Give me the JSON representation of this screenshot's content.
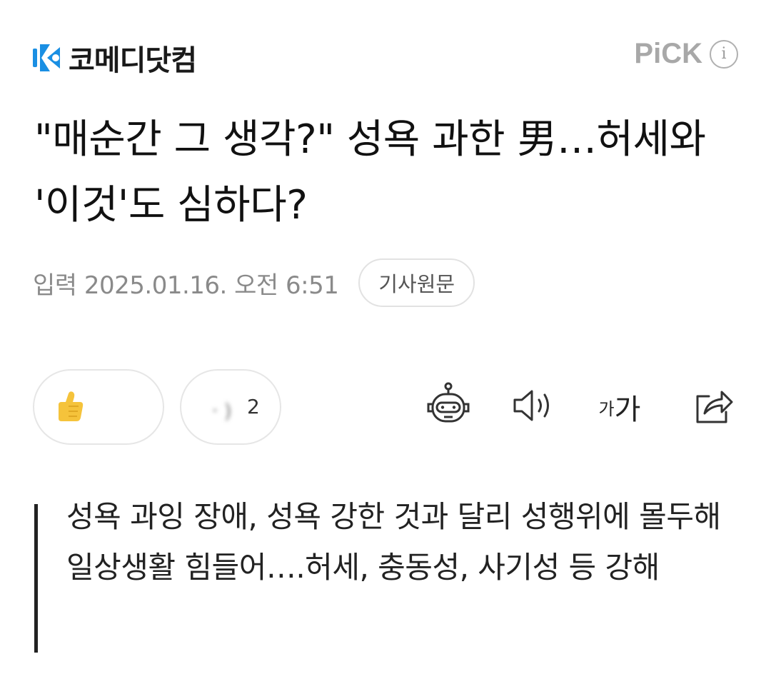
{
  "header": {
    "logo_text": "코메디닷컴",
    "pick_label": "PiCK",
    "info_icon_glyph": "i",
    "brand_color": "#1a8fe3"
  },
  "article": {
    "title": "\"매순간 그 생각?\" 성욕 과한 男…허세와 '이것'도 심하다?",
    "date": "입력 2025.01.16. 오전 6:51",
    "original_button": "기사원문",
    "summary": "성욕 과잉 장애, 성욕 강한 것과 달리 성행위에 몰두해 일상생활 힘들어….허세, 충동성, 사기성 등 강해"
  },
  "reactions": {
    "like_count": "",
    "comment_count": "2",
    "comment_label_blurred": "ㆍ)"
  },
  "toolbar": {
    "robot_icon": "robot-summary-icon",
    "speaker_icon": "speaker-icon",
    "font_small": "가",
    "font_large": "가",
    "share_icon": "share-icon"
  }
}
